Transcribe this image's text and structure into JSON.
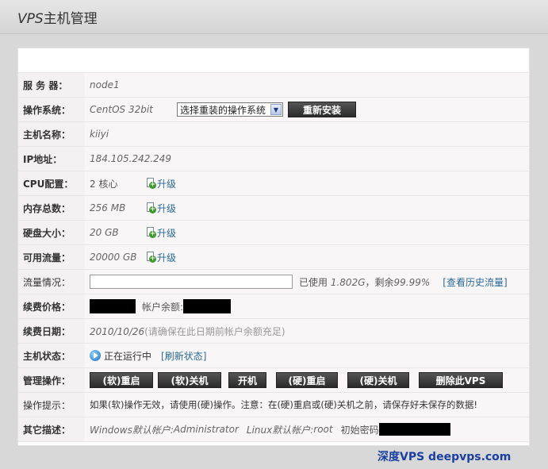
{
  "header": {
    "title_en": "VPS",
    "title_cn": "主机管理"
  },
  "rows": {
    "server": {
      "label": "服 务 器：",
      "value": "node1"
    },
    "os": {
      "label": "操作系统：",
      "value": "CentOS 32bit",
      "select_value": "选择重装的操作系统",
      "reinstall_label": "重新安装"
    },
    "hostname": {
      "label": "主机名称：",
      "value": "kiiyi"
    },
    "ip": {
      "label": "IP地址：",
      "value": "184.105.242.249"
    },
    "cpu": {
      "label": "CPU配置：",
      "value": "2 核心",
      "upgrade": "升级"
    },
    "mem": {
      "label": "内存总数：",
      "value": "256 MB",
      "upgrade": "升级"
    },
    "disk": {
      "label": "硬盘大小：",
      "value": "20 GB",
      "upgrade": "升级"
    },
    "traffic": {
      "label": "可用流量：",
      "value": "20000 GB",
      "upgrade": "升级"
    },
    "usage": {
      "label": "流量情况：",
      "used_prefix": "已使用",
      "used_value": "1.802G",
      "remain_prefix": "，剩余",
      "remain_value": "99.99%",
      "history_link": "[查看历史流量]"
    },
    "price": {
      "label": "续费价格：",
      "balance_label": "帐户余额:"
    },
    "date": {
      "label": "续费日期：",
      "value": "2010/10/26",
      "note": "(请确保在此日期前帐户余额充足)"
    },
    "status": {
      "label": "主机状态：",
      "value": "正在运行中",
      "refresh_link": "[刷新状态]"
    },
    "ops": {
      "label": "管理操作：",
      "buttons": [
        "(软)重启",
        "(软)关机",
        "开机",
        "(硬)重启",
        "(硬)关机",
        "删除此VPS"
      ]
    },
    "tip": {
      "label": "操作提示：",
      "value": "如果(软)操作无效，请使用(硬)操作。注意：在(硬)重启或(硬)关机之前，请保存好未保存的数据!"
    },
    "other": {
      "label": "其它描述：",
      "win_prefix": "Windows默认帐户:",
      "win_user": "Administrator",
      "linux_prefix": "Linux默认帐户:",
      "linux_user": "root",
      "pwd_label": "初始密码"
    }
  },
  "watermark": "深度VPS  deepvps.com"
}
